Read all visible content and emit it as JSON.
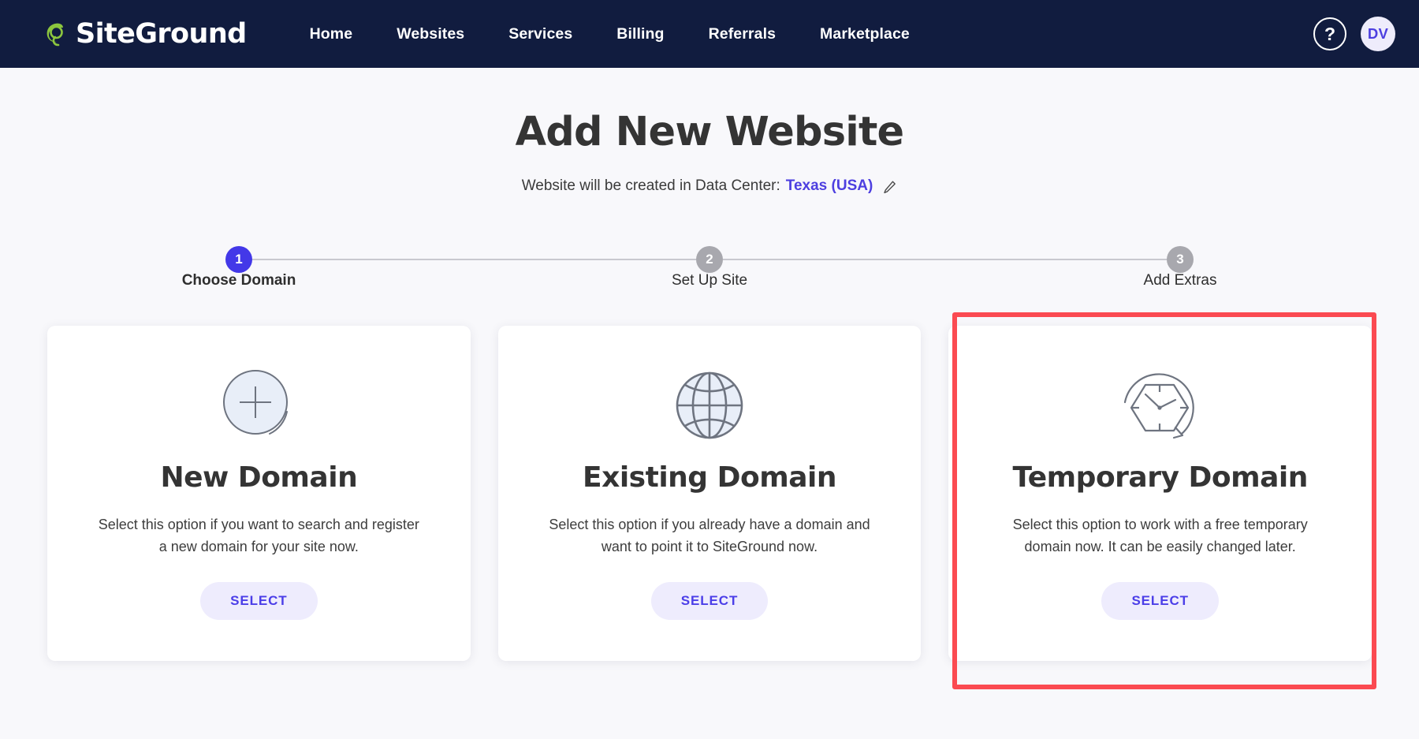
{
  "topnav": {
    "brand": "SiteGround",
    "brand_icon": "siteground-logo-icon",
    "links": [
      {
        "label": "Home"
      },
      {
        "label": "Websites"
      },
      {
        "label": "Services"
      },
      {
        "label": "Billing"
      },
      {
        "label": "Referrals"
      },
      {
        "label": "Marketplace"
      }
    ],
    "help_label": "?",
    "help_icon": "question-mark-icon",
    "avatar_initials": "DV"
  },
  "page": {
    "title": "Add New Website",
    "subtitle_prefix": "Website will be created in Data Center:",
    "data_center": "Texas (USA)",
    "edit_icon": "pencil-edit-icon"
  },
  "stepper": {
    "steps": [
      {
        "number": "1",
        "label": "Choose Domain",
        "state": "active"
      },
      {
        "number": "2",
        "label": "Set Up Site",
        "state": "inactive"
      },
      {
        "number": "3",
        "label": "Add Extras",
        "state": "inactive"
      }
    ]
  },
  "cards": [
    {
      "icon": "plus-circle-icon",
      "title": "New Domain",
      "description": "Select this option if you want to search and register a new domain for your site now.",
      "button_label": "SELECT",
      "highlighted": false
    },
    {
      "icon": "globe-icon",
      "title": "Existing Domain",
      "description": "Select this option if you already have a domain and want to point it to SiteGround now.",
      "button_label": "SELECT",
      "highlighted": false
    },
    {
      "icon": "hexagon-clock-arrow-icon",
      "title": "Temporary Domain",
      "description": "Select this option to work with a free temporary domain now. It can be easily changed later.",
      "button_label": "SELECT",
      "highlighted": true
    }
  ],
  "colors": {
    "nav_background": "#111c3f",
    "accent_purple": "#4d3fe0",
    "brand_green": "#8cc63e",
    "highlight_red": "#fb4a51",
    "page_background": "#f8f8fb",
    "icon_stroke": "#6e7480",
    "icon_fill": "#e8eef8"
  }
}
